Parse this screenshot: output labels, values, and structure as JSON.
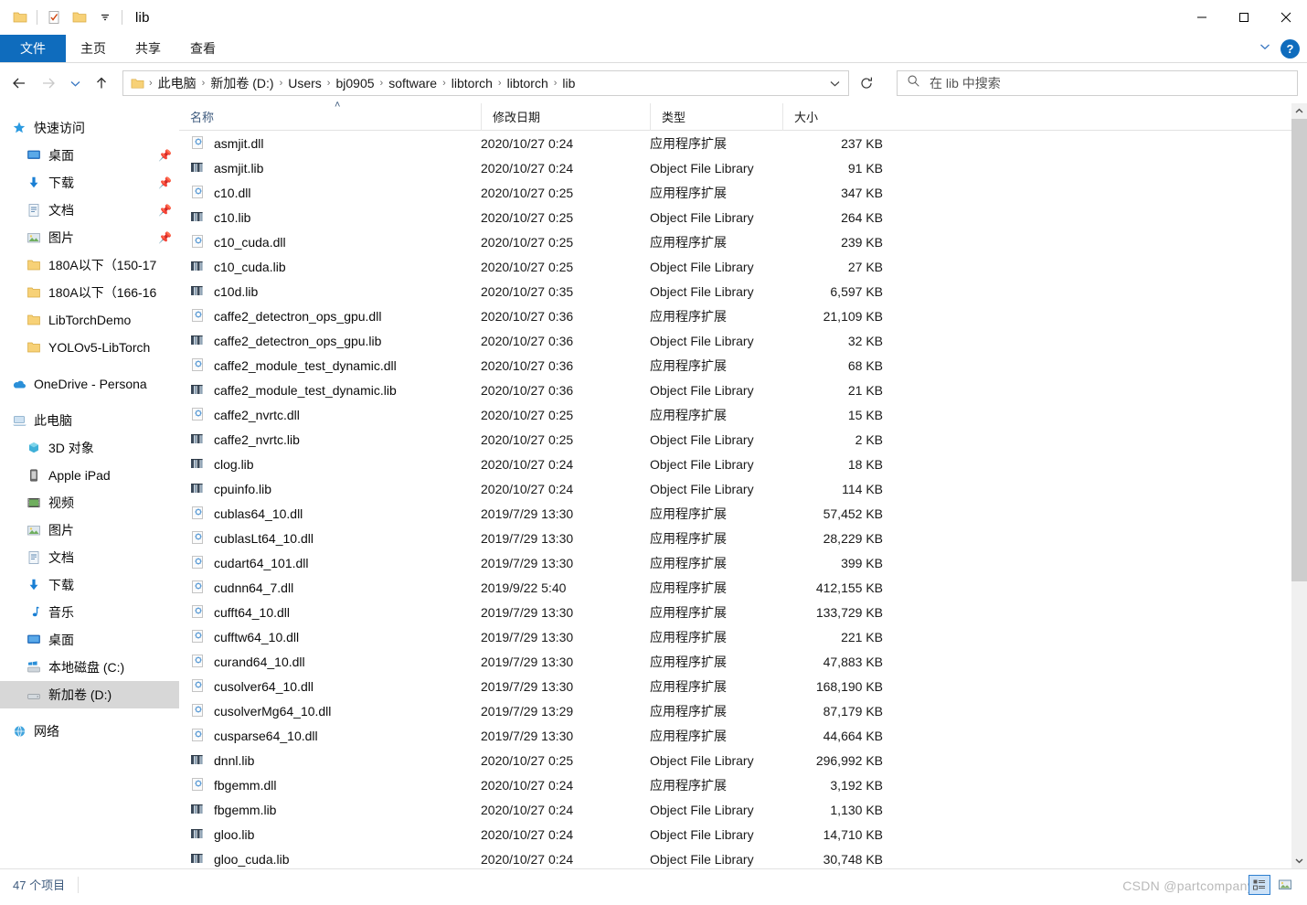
{
  "window": {
    "title": "lib",
    "quick_access": [
      "folder-icon",
      "properties-icon",
      "new-folder-icon",
      "customize-dropdown-icon"
    ],
    "controls": {
      "minimize": "—",
      "maximize": "□",
      "close": "✕"
    }
  },
  "ribbon": {
    "tabs": [
      {
        "label": "文件",
        "active": true
      },
      {
        "label": "主页",
        "active": false
      },
      {
        "label": "共享",
        "active": false
      },
      {
        "label": "查看",
        "active": false
      }
    ],
    "expand_icon": "chevron-down-icon",
    "help_label": "?"
  },
  "address": {
    "back_icon": "arrow-left-icon",
    "forward_icon": "arrow-right-icon",
    "recent_icon": "chevron-down-icon",
    "up_icon": "arrow-up-icon",
    "breadcrumbs": [
      "此电脑",
      "新加卷 (D:)",
      "Users",
      "bj0905",
      "software",
      "libtorch",
      "libtorch",
      "lib"
    ],
    "separator": "›",
    "dropdown_icon": "chevron-down-icon",
    "refresh_icon": "refresh-icon"
  },
  "search": {
    "icon": "search-icon",
    "placeholder": "在 lib 中搜索"
  },
  "sidebar": {
    "groups": [
      {
        "header": {
          "label": "快速访问",
          "icon": "star-icon"
        },
        "items": [
          {
            "label": "桌面",
            "icon": "desktop-icon",
            "pinned": true
          },
          {
            "label": "下载",
            "icon": "download-icon",
            "pinned": true
          },
          {
            "label": "文档",
            "icon": "documents-icon",
            "pinned": true
          },
          {
            "label": "图片",
            "icon": "pictures-icon",
            "pinned": true
          },
          {
            "label": "180A以下（150-17",
            "icon": "folder-icon",
            "pinned": false
          },
          {
            "label": "180A以下（166-16",
            "icon": "folder-icon",
            "pinned": false
          },
          {
            "label": "LibTorchDemo",
            "icon": "folder-icon",
            "pinned": false
          },
          {
            "label": "YOLOv5-LibTorch",
            "icon": "folder-icon",
            "pinned": false
          }
        ]
      },
      {
        "header": {
          "label": "OneDrive - Persona",
          "icon": "onedrive-icon"
        },
        "items": []
      },
      {
        "header": {
          "label": "此电脑",
          "icon": "computer-icon"
        },
        "items": [
          {
            "label": "3D 对象",
            "icon": "3d-objects-icon",
            "selected": false
          },
          {
            "label": "Apple iPad",
            "icon": "device-icon",
            "selected": false
          },
          {
            "label": "视频",
            "icon": "videos-icon",
            "selected": false
          },
          {
            "label": "图片",
            "icon": "pictures-icon",
            "selected": false
          },
          {
            "label": "文档",
            "icon": "documents-icon",
            "selected": false
          },
          {
            "label": "下载",
            "icon": "download-icon",
            "selected": false
          },
          {
            "label": "音乐",
            "icon": "music-icon",
            "selected": false
          },
          {
            "label": "桌面",
            "icon": "desktop-icon",
            "selected": false
          },
          {
            "label": "本地磁盘 (C:)",
            "icon": "windows-drive-icon",
            "selected": false
          },
          {
            "label": "新加卷 (D:)",
            "icon": "drive-icon",
            "selected": true
          }
        ]
      },
      {
        "header": {
          "label": "网络",
          "icon": "network-icon"
        },
        "items": []
      }
    ]
  },
  "filelist": {
    "columns": [
      {
        "label": "名称",
        "sorted": true,
        "sort_dir": "asc"
      },
      {
        "label": "修改日期",
        "sorted": false
      },
      {
        "label": "类型",
        "sorted": false
      },
      {
        "label": "大小",
        "sorted": false
      }
    ],
    "sort_indicator": "˄",
    "rows": [
      {
        "name": "asmjit.dll",
        "date": "2020/10/27 0:24",
        "type": "应用程序扩展",
        "size": "237 KB",
        "icon": "dll-icon"
      },
      {
        "name": "asmjit.lib",
        "date": "2020/10/27 0:24",
        "type": "Object File Library",
        "size": "91 KB",
        "icon": "lib-icon"
      },
      {
        "name": "c10.dll",
        "date": "2020/10/27 0:25",
        "type": "应用程序扩展",
        "size": "347 KB",
        "icon": "dll-icon"
      },
      {
        "name": "c10.lib",
        "date": "2020/10/27 0:25",
        "type": "Object File Library",
        "size": "264 KB",
        "icon": "lib-icon"
      },
      {
        "name": "c10_cuda.dll",
        "date": "2020/10/27 0:25",
        "type": "应用程序扩展",
        "size": "239 KB",
        "icon": "dll-icon"
      },
      {
        "name": "c10_cuda.lib",
        "date": "2020/10/27 0:25",
        "type": "Object File Library",
        "size": "27 KB",
        "icon": "lib-icon"
      },
      {
        "name": "c10d.lib",
        "date": "2020/10/27 0:35",
        "type": "Object File Library",
        "size": "6,597 KB",
        "icon": "lib-icon"
      },
      {
        "name": "caffe2_detectron_ops_gpu.dll",
        "date": "2020/10/27 0:36",
        "type": "应用程序扩展",
        "size": "21,109 KB",
        "icon": "dll-icon"
      },
      {
        "name": "caffe2_detectron_ops_gpu.lib",
        "date": "2020/10/27 0:36",
        "type": "Object File Library",
        "size": "32 KB",
        "icon": "lib-icon"
      },
      {
        "name": "caffe2_module_test_dynamic.dll",
        "date": "2020/10/27 0:36",
        "type": "应用程序扩展",
        "size": "68 KB",
        "icon": "dll-icon"
      },
      {
        "name": "caffe2_module_test_dynamic.lib",
        "date": "2020/10/27 0:36",
        "type": "Object File Library",
        "size": "21 KB",
        "icon": "lib-icon"
      },
      {
        "name": "caffe2_nvrtc.dll",
        "date": "2020/10/27 0:25",
        "type": "应用程序扩展",
        "size": "15 KB",
        "icon": "dll-icon"
      },
      {
        "name": "caffe2_nvrtc.lib",
        "date": "2020/10/27 0:25",
        "type": "Object File Library",
        "size": "2 KB",
        "icon": "lib-icon"
      },
      {
        "name": "clog.lib",
        "date": "2020/10/27 0:24",
        "type": "Object File Library",
        "size": "18 KB",
        "icon": "lib-icon"
      },
      {
        "name": "cpuinfo.lib",
        "date": "2020/10/27 0:24",
        "type": "Object File Library",
        "size": "114 KB",
        "icon": "lib-icon"
      },
      {
        "name": "cublas64_10.dll",
        "date": "2019/7/29 13:30",
        "type": "应用程序扩展",
        "size": "57,452 KB",
        "icon": "dll-icon"
      },
      {
        "name": "cublasLt64_10.dll",
        "date": "2019/7/29 13:30",
        "type": "应用程序扩展",
        "size": "28,229 KB",
        "icon": "dll-icon"
      },
      {
        "name": "cudart64_101.dll",
        "date": "2019/7/29 13:30",
        "type": "应用程序扩展",
        "size": "399 KB",
        "icon": "dll-icon"
      },
      {
        "name": "cudnn64_7.dll",
        "date": "2019/9/22 5:40",
        "type": "应用程序扩展",
        "size": "412,155 KB",
        "icon": "dll-icon"
      },
      {
        "name": "cufft64_10.dll",
        "date": "2019/7/29 13:30",
        "type": "应用程序扩展",
        "size": "133,729 KB",
        "icon": "dll-icon"
      },
      {
        "name": "cufftw64_10.dll",
        "date": "2019/7/29 13:30",
        "type": "应用程序扩展",
        "size": "221 KB",
        "icon": "dll-icon"
      },
      {
        "name": "curand64_10.dll",
        "date": "2019/7/29 13:30",
        "type": "应用程序扩展",
        "size": "47,883 KB",
        "icon": "dll-icon"
      },
      {
        "name": "cusolver64_10.dll",
        "date": "2019/7/29 13:30",
        "type": "应用程序扩展",
        "size": "168,190 KB",
        "icon": "dll-icon"
      },
      {
        "name": "cusolverMg64_10.dll",
        "date": "2019/7/29 13:29",
        "type": "应用程序扩展",
        "size": "87,179 KB",
        "icon": "dll-icon"
      },
      {
        "name": "cusparse64_10.dll",
        "date": "2019/7/29 13:30",
        "type": "应用程序扩展",
        "size": "44,664 KB",
        "icon": "dll-icon"
      },
      {
        "name": "dnnl.lib",
        "date": "2020/10/27 0:25",
        "type": "Object File Library",
        "size": "296,992 KB",
        "icon": "lib-icon"
      },
      {
        "name": "fbgemm.dll",
        "date": "2020/10/27 0:24",
        "type": "应用程序扩展",
        "size": "3,192 KB",
        "icon": "dll-icon"
      },
      {
        "name": "fbgemm.lib",
        "date": "2020/10/27 0:24",
        "type": "Object File Library",
        "size": "1,130 KB",
        "icon": "lib-icon"
      },
      {
        "name": "gloo.lib",
        "date": "2020/10/27 0:24",
        "type": "Object File Library",
        "size": "14,710 KB",
        "icon": "lib-icon"
      },
      {
        "name": "gloo_cuda.lib",
        "date": "2020/10/27 0:24",
        "type": "Object File Library",
        "size": "30,748 KB",
        "icon": "lib-icon"
      }
    ]
  },
  "statusbar": {
    "item_count": "47 个项目",
    "view_details_icon": "details-view-icon",
    "view_large_icons_icon": "large-icons-view-icon",
    "watermark": "CSDN @partcompany"
  },
  "colors": {
    "accent": "#0f6cbd",
    "selection": "#d7d7d7",
    "header_text": "#3d5a7d",
    "folder": "#f7d177"
  }
}
